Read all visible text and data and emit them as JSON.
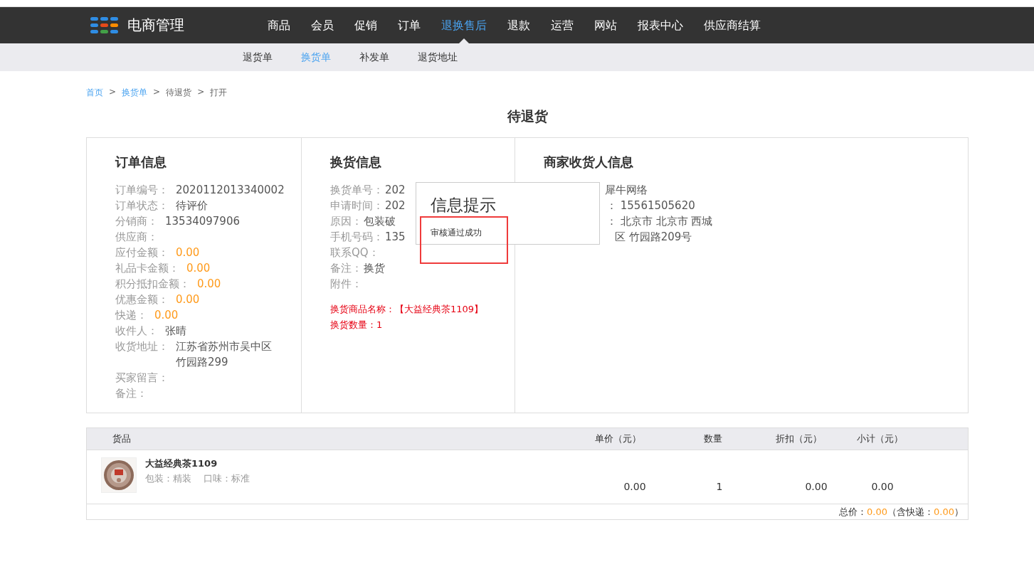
{
  "nav": {
    "logo_text": "电商管理",
    "items": [
      {
        "label": "商品",
        "selected": false
      },
      {
        "label": "会员",
        "selected": false
      },
      {
        "label": "促销",
        "selected": false
      },
      {
        "label": "订单",
        "selected": false
      },
      {
        "label": "退换售后",
        "selected": true
      },
      {
        "label": "退款",
        "selected": false
      },
      {
        "label": "运营",
        "selected": false
      },
      {
        "label": "网站",
        "selected": false
      },
      {
        "label": "报表中心",
        "selected": false
      },
      {
        "label": "供应商结算",
        "selected": false
      }
    ]
  },
  "sub_nav": [
    {
      "label": "退货单",
      "selected": false
    },
    {
      "label": "换货单",
      "selected": true
    },
    {
      "label": "补发单",
      "selected": false
    },
    {
      "label": "退货地址",
      "selected": false
    }
  ],
  "breadcrumb": [
    {
      "label": "首页",
      "kind": "link"
    },
    {
      "label": ">",
      "kind": "separator"
    },
    {
      "label": "换货单",
      "kind": "link"
    },
    {
      "label": ">",
      "kind": "separator"
    },
    {
      "label": "待退货",
      "kind": "text"
    },
    {
      "label": ">",
      "kind": "separator"
    },
    {
      "label": "打开",
      "kind": "text"
    }
  ],
  "page_title": "待退货",
  "order_info": {
    "title": "订单信息",
    "rows": [
      {
        "label": "订单编号：",
        "value": "2020112013340002",
        "kind": "plain"
      },
      {
        "label": "订单状态：",
        "value": "待评价",
        "kind": "plain"
      },
      {
        "label": "分销商：",
        "value": "13534097906",
        "kind": "plain"
      },
      {
        "label": "供应商："
      },
      {
        "label": "应付金额：",
        "value": "0.00",
        "kind": "amount"
      },
      {
        "label": "礼品卡金额：",
        "value": "0.00",
        "kind": "amount"
      },
      {
        "label": "积分抵扣金额：",
        "value": "0.00",
        "kind": "amount"
      },
      {
        "label": "优惠金额：",
        "value": "0.00",
        "kind": "amount"
      },
      {
        "label": "快递：",
        "value": "0.00",
        "kind": "amount"
      },
      {
        "label": "收件人：",
        "value": "张晴",
        "kind": "plain"
      },
      {
        "label": "收货地址：",
        "lines": [
          "江苏省苏州市吴中区",
          "竹园路299"
        ],
        "kind": "plain"
      },
      {
        "label": "买家留言："
      },
      {
        "label": "备注："
      }
    ]
  },
  "exchange_info": {
    "title": "换货信息",
    "rows": [
      {
        "label": "换货单号：",
        "value": "202"
      },
      {
        "label": "申请时间：",
        "value": "202"
      },
      {
        "label": "原因：",
        "value": "包装破"
      },
      {
        "label": "手机号码：",
        "value": "135"
      },
      {
        "label": "联系QQ："
      },
      {
        "label": "备注：",
        "value": "换货"
      },
      {
        "label": "附件："
      }
    ],
    "goods": [
      {
        "label": "换货商品名称：",
        "value": "【大益经典茶1109】"
      },
      {
        "label": "换货数量：",
        "value": "1"
      }
    ]
  },
  "merchant_info": {
    "title": "商家收货人信息",
    "lines": [
      "犀牛网络",
      "：  15561505620",
      "：  北京市 北京市 西城",
      "区 竹园路209号"
    ]
  },
  "table": {
    "columns": [
      "货品",
      "单价（元）",
      "数量",
      "折扣（元）",
      "小计（元）"
    ],
    "rows": [
      {
        "name": "大益经典茶1109",
        "spec": "包装：精装    口味：标准",
        "price": "0.00",
        "quantity": "1",
        "discount": "0.00",
        "subtotal": "0.00"
      }
    ],
    "total": {
      "label": "总价：",
      "value": "0.00",
      "shipping_open": "（含快递：",
      "shipping_value": "0.00",
      "close": "）"
    }
  },
  "dialog": {
    "title": "信息提示",
    "message": "审核通过成功",
    "highlighted": true
  }
}
